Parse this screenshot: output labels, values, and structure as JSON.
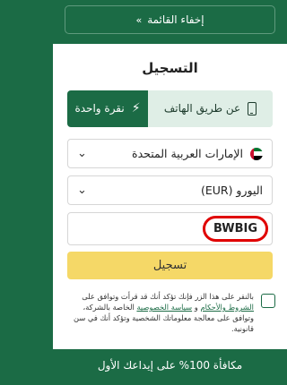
{
  "top": {
    "hide_menu_label": "إخفاء القائمة",
    "hide_menu_chevron": "»"
  },
  "form": {
    "title": "التسجيل",
    "tabs": {
      "phone": "عن طريق الهاتف",
      "oneclick": "نقرة واحدة"
    },
    "country": "الإمارات العربية المتحدة",
    "currency": "اليورو (EUR)",
    "promo_code": "BWBIG",
    "submit_label": "تسجيل",
    "consent": {
      "part1": "بالنقر على هذا الزر فإنك تؤكد أنك قد قرأت وتوافق على ",
      "terms_link": "الشروط والأحكام",
      "and": " و ",
      "privacy_link": "سياسة الخصوصية",
      "part2": " الخاصة بالشركة، وتوافق على معالجة معلوماتك الشخصية وتؤكد أنك في سن قانونية."
    }
  },
  "bonus_banner": "مكافأة 100% على إيداعك الأول",
  "colors": {
    "brand_green": "#1b6b45",
    "submit_yellow": "#f5d867",
    "highlight_red": "#e00000"
  },
  "icons": {
    "phone": "phone-icon",
    "oneclick": "lightning-bolt-icon",
    "flag": "uae-flag-icon",
    "dropdown": "chevron-down-icon"
  }
}
